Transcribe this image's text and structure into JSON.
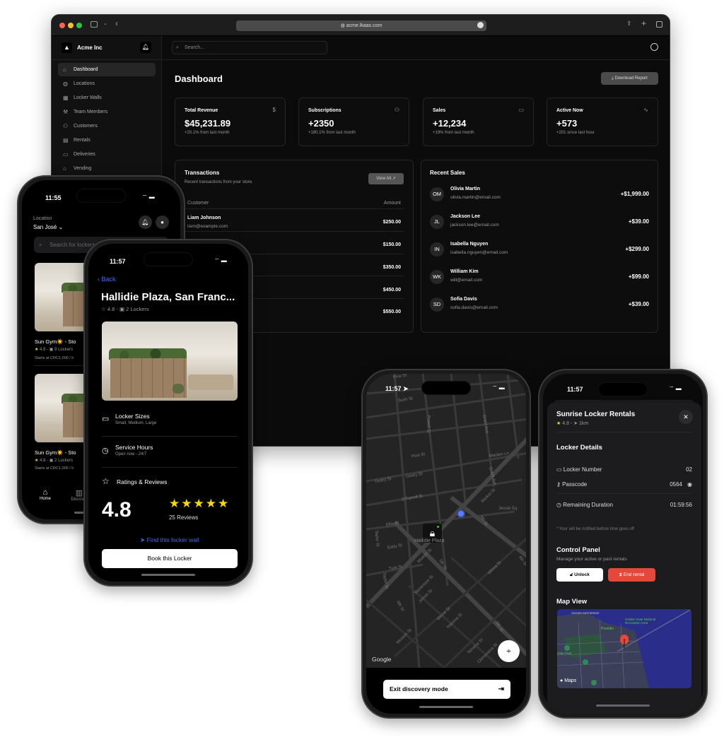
{
  "browser": {
    "url": "acme.lkaas.com"
  },
  "sidebar": {
    "brand": "Acme Inc",
    "items": [
      {
        "label": "Dashboard",
        "icon": "home-icon"
      },
      {
        "label": "Locations",
        "icon": "globe-icon"
      },
      {
        "label": "Locker Walls",
        "icon": "grid-icon"
      },
      {
        "label": "Team Members",
        "icon": "hammer-icon"
      },
      {
        "label": "Customers",
        "icon": "users-icon"
      },
      {
        "label": "Rentals",
        "icon": "calendar-icon"
      },
      {
        "label": "Deliveries",
        "icon": "package-icon"
      },
      {
        "label": "Vending",
        "icon": "store-icon"
      }
    ]
  },
  "header": {
    "search_placeholder": "Search..."
  },
  "dashboard": {
    "title": "Dashboard",
    "download_label": "Download Report",
    "stats": [
      {
        "title": "Total Revenue",
        "value": "$45,231.89",
        "sub": "+20.1% from last month",
        "icon": "$"
      },
      {
        "title": "Subscriptions",
        "value": "+2350",
        "sub": "+180.1% from last month",
        "icon": "users-icon"
      },
      {
        "title": "Sales",
        "value": "+12,234",
        "sub": "+19% from last month",
        "icon": "credit-card-icon"
      },
      {
        "title": "Active Now",
        "value": "+573",
        "sub": "+201 since last hour",
        "icon": "activity-icon"
      }
    ],
    "transactions": {
      "title": "Transactions",
      "subtitle": "Recent transactions from your store.",
      "view_all": "View All",
      "col_customer": "Customer",
      "col_amount": "Amount",
      "rows": [
        {
          "name": "Liam Johnson",
          "email": "liam@example.com",
          "amount": "$250.00"
        },
        {
          "amount": "$150.00"
        },
        {
          "amount": "$350.00"
        },
        {
          "amount": "$450.00"
        },
        {
          "amount": "$550.00"
        }
      ]
    },
    "recent_sales": {
      "title": "Recent Sales",
      "rows": [
        {
          "initials": "OM",
          "name": "Olivia Martin",
          "email": "olivia.martin@email.com",
          "amount": "+$1,999.00"
        },
        {
          "initials": "JL",
          "name": "Jackson Lee",
          "email": "jackson.lee@email.com",
          "amount": "+$39.00"
        },
        {
          "initials": "IN",
          "name": "Isabella Nguyen",
          "email": "isabella.nguyen@email.com",
          "amount": "+$299.00"
        },
        {
          "initials": "WK",
          "name": "William Kim",
          "email": "will@email.com",
          "amount": "+$99.00"
        },
        {
          "initials": "SD",
          "name": "Sofia Davis",
          "email": "sofia.davis@email.com",
          "amount": "+$39.00"
        }
      ]
    }
  },
  "phone_home": {
    "time": "11:55",
    "location_label": "Location",
    "location": "San José",
    "search_placeholder": "Search for lockers",
    "cards": [
      {
        "title": "Sun Gym☀️ - Sto",
        "rating": "4.8",
        "lockers": "9 Lockers",
        "price": "Starts at CRC1,000 / h"
      },
      {
        "title": "Sun Gym☀️ - Sto",
        "rating": "4.8",
        "lockers": "2 Lockers",
        "price": "Starts at CRC1,000 / h"
      }
    ],
    "tabs": [
      {
        "label": "Home"
      },
      {
        "label": "Discover"
      }
    ]
  },
  "phone_detail": {
    "time": "11:57",
    "back": "Back",
    "title": "Hallidie Plaza, San Franc...",
    "rating": "4.8",
    "lockers": "2 Lockers",
    "locker_sizes": "Locker Sizes",
    "locker_sizes_sub": "Small, Medium, Large",
    "service_hours": "Service Hours",
    "service_hours_sub": "Open now - 24/7",
    "ratings_title": "Ratings & Reviews",
    "big_rating": "4.8",
    "stars": 5,
    "reviews": "25 Reviews",
    "find": "Find this locker wall",
    "book": "Book this Locker",
    "accent": "#3b6cf6",
    "star_color": "#f5d90a"
  },
  "phone_map": {
    "time": "11:57",
    "exit": "Exit discovery mode",
    "attribution": "Google",
    "marker_label": "Hallidie Plaza",
    "streets": [
      "Pine St",
      "Bush St",
      "Powell St",
      "Grant Ave",
      "Post St",
      "Maiden Ln",
      "Geary St",
      "Geary St",
      "Grant Ave",
      "Market St",
      "O'Farrell St",
      "Jessie Sq",
      "4th St",
      "Ellis St",
      "Taylor St",
      "Eddy St",
      "Market St",
      "5th St",
      "Turk St",
      "Minna St",
      "4th St",
      "Stevenson St",
      "Jessie St",
      "6th St",
      "Minna St",
      "Natoma St",
      "5th St",
      "Mission St",
      "Tehama St",
      "Clementina St",
      "Taylor St"
    ]
  },
  "phone_rental": {
    "time": "11:57",
    "title": "Sunrise Locker Rentals",
    "rating": "4.8",
    "distance": "1km",
    "details_title": "Locker Details",
    "locker_number_label": "Locker Number",
    "locker_number": "02",
    "passcode_label": "Passcode",
    "passcode": "0564",
    "remaining_label": "Remaining Duration",
    "remaining": "01:59:56",
    "note": "* Your will be notified before time goes off",
    "control_title": "Control Panel",
    "control_sub": "Manage your active or past rentals",
    "unlock": "Unlock",
    "end": "End rental",
    "end_color": "#e5473a",
    "map_title": "Map View",
    "map_attribution": "Maps",
    "map_labels": [
      "GOLDEN GATE BRIDGE",
      "Presidio",
      "Golden Gate National Recreation Area",
      "Gate Park"
    ]
  }
}
